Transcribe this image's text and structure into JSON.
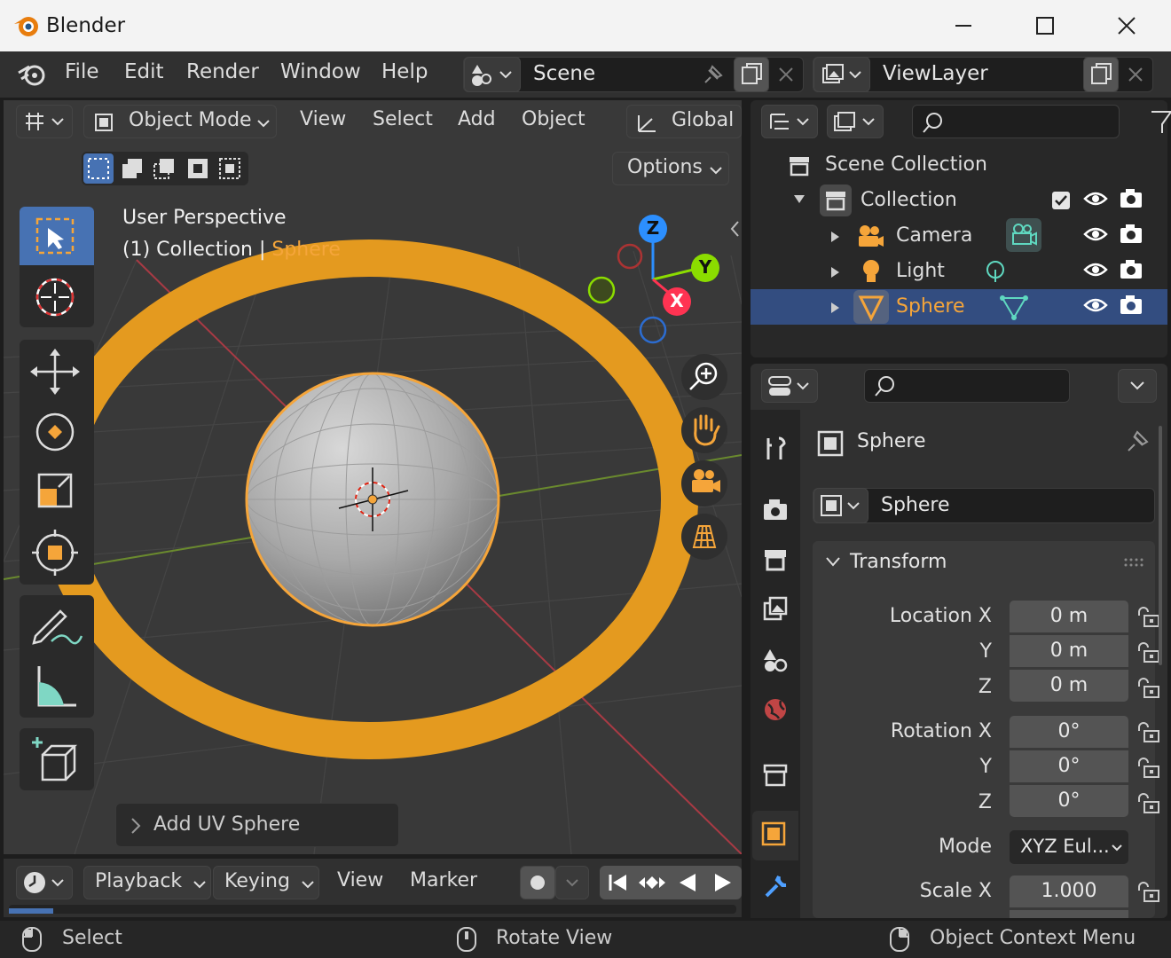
{
  "window": {
    "title": "Blender"
  },
  "menubar": {
    "items": [
      "File",
      "Edit",
      "Render",
      "Window",
      "Help"
    ],
    "scene": "Scene",
    "view_layer": "ViewLayer"
  },
  "viewport": {
    "mode": "Object Mode",
    "menus": [
      "View",
      "Select",
      "Add",
      "Object"
    ],
    "orientation": "Global",
    "options": "Options",
    "overlay_line1": "User Perspective",
    "overlay_line2_prefix": "(1) Collection | ",
    "overlay_line2_object": "Sphere",
    "last_operator": "Add UV Sphere",
    "gizmo_axes": [
      "Z",
      "Y",
      "X"
    ]
  },
  "outliner": {
    "rows": [
      {
        "label": "Scene Collection"
      },
      {
        "label": "Collection"
      },
      {
        "label": "Camera"
      },
      {
        "label": "Light"
      },
      {
        "label": "Sphere"
      }
    ]
  },
  "properties": {
    "object_name": "Sphere",
    "data_name": "Sphere",
    "panel_title": "Transform",
    "location_label": "Location X",
    "rotation_label": "Rotation X",
    "y_label": "Y",
    "z_label": "Z",
    "location": [
      "0 m",
      "0 m",
      "0 m"
    ],
    "rotation": [
      "0°",
      "0°",
      "0°"
    ],
    "mode_label": "Mode",
    "mode_value": "XYZ Eul...",
    "scale_label": "Scale X",
    "scale_x": "1.000"
  },
  "timeline": {
    "menus": [
      "Playback",
      "Keying",
      "View",
      "Marker"
    ]
  },
  "statusbar": {
    "left": "Select",
    "middle": "Rotate View",
    "right": "Object Context Menu"
  },
  "colors": {
    "accent_orange": "#f5a53a",
    "selection_blue": "#334d80",
    "x_axis": "#ff3352",
    "y_axis": "#8bdc00",
    "z_axis": "#2c8fff"
  }
}
